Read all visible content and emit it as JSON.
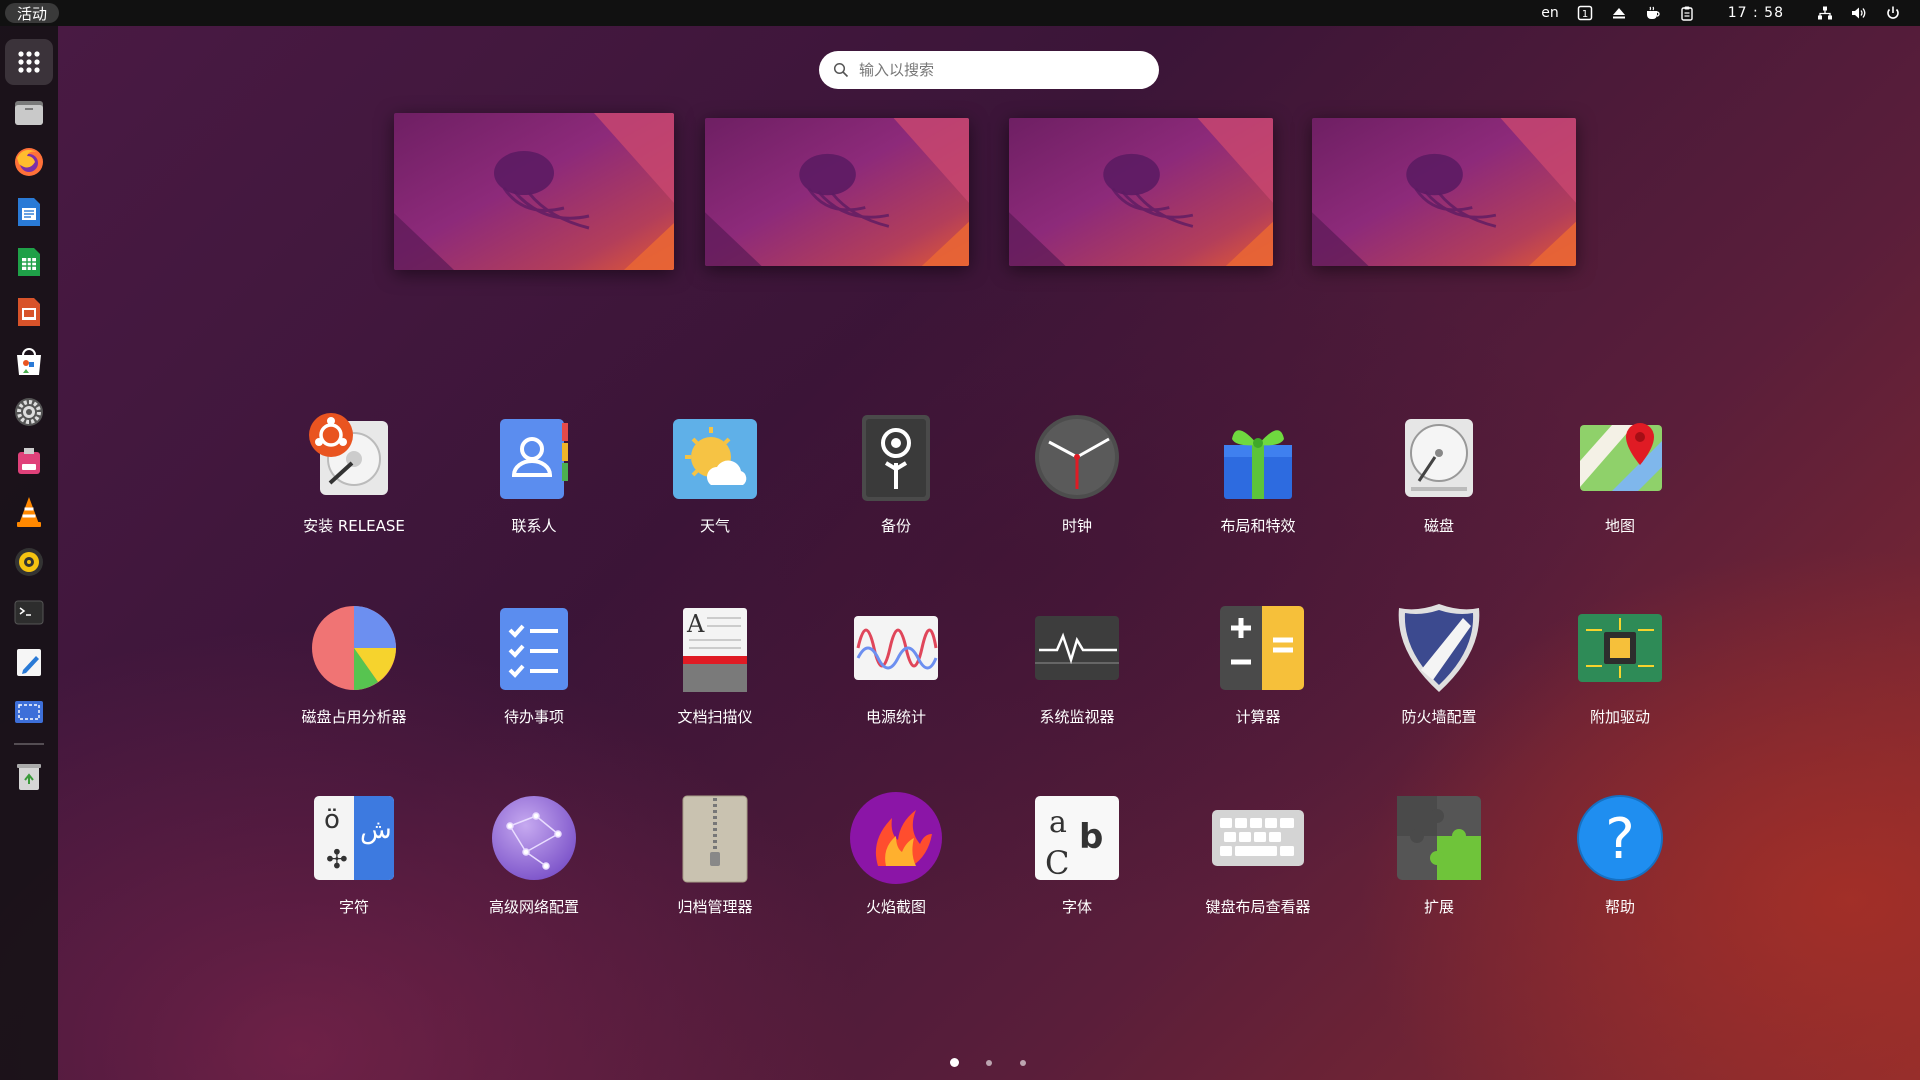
{
  "topbar": {
    "activities": "活动",
    "language": "en",
    "clock": "17 : 58"
  },
  "search": {
    "placeholder": "输入以搜索"
  },
  "dock": {
    "items": [
      "show-apps",
      "files",
      "firefox",
      "writer",
      "calc",
      "impress",
      "app-center",
      "settings",
      "usb-creator",
      "vlc",
      "rhythmbox",
      "terminal",
      "text-editor",
      "screenshot",
      "trash"
    ]
  },
  "apps": {
    "row1": [
      "安装 RELEASE",
      "联系人",
      "天气",
      "备份",
      "时钟",
      "布局和特效",
      "磁盘",
      "地图"
    ],
    "row2": [
      "磁盘占用分析器",
      "待办事项",
      "文档扫描仪",
      "电源统计",
      "系统监视器",
      "计算器",
      "防火墙配置",
      "附加驱动"
    ],
    "row3": [
      "字符",
      "高级网络配置",
      "归档管理器",
      "火焰截图",
      "字体",
      "键盘布局查看器",
      "扩展",
      "帮助"
    ]
  },
  "workspaces": 4,
  "pages": {
    "count": 3,
    "current": 1
  },
  "colors": {
    "accent": "#e95420",
    "topbar": "#111111",
    "dock": "#181218"
  }
}
